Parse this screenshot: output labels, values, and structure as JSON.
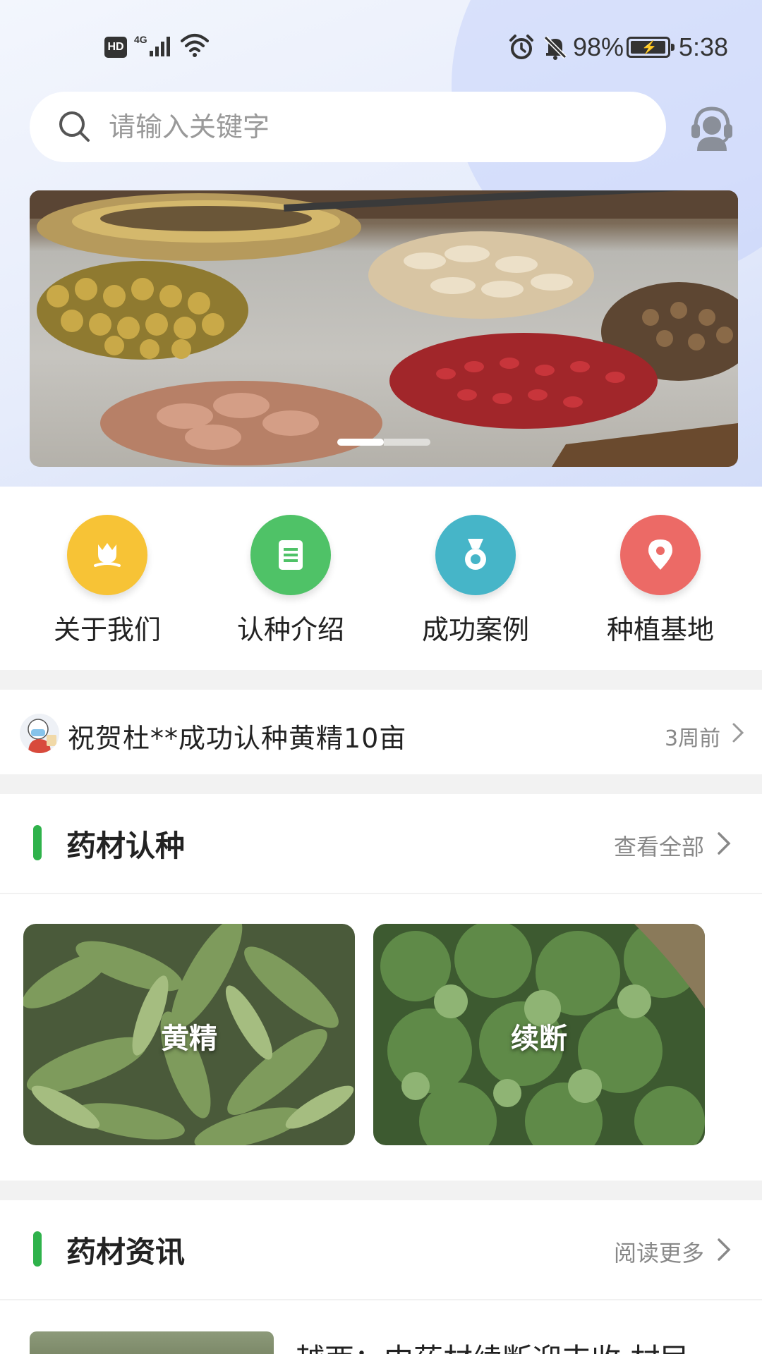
{
  "status_bar": {
    "hd": "HD",
    "network": "4G",
    "battery_percent": "98%",
    "battery_level": 0.98,
    "time": "5:38"
  },
  "search": {
    "placeholder": "请输入关键字"
  },
  "banner": {
    "slide_count": 2,
    "active_index": 0
  },
  "quick_nav": [
    {
      "label": "关于我们",
      "color": "#f7c336",
      "icon": "tulip-icon"
    },
    {
      "label": "认种介绍",
      "color": "#4fc267",
      "icon": "document-icon"
    },
    {
      "label": "成功案例",
      "color": "#46b5c8",
      "icon": "medal-icon"
    },
    {
      "label": "种植基地",
      "color": "#ec6a66",
      "icon": "location-pin-icon"
    }
  ],
  "notice": {
    "text": "祝贺杜**成功认种黄精10亩",
    "time": "3周前"
  },
  "crops_section": {
    "title": "药材认种",
    "more": "查看全部",
    "items": [
      {
        "name": "黄精"
      },
      {
        "name": "续断"
      }
    ]
  },
  "news_section": {
    "title": "药材资讯",
    "more": "阅读更多",
    "items": [
      {
        "title": "越西：中药材续断迎丰收 村民"
      }
    ]
  },
  "colors": {
    "accent_green": "#2fb24b",
    "background": "#f2f2f2"
  }
}
